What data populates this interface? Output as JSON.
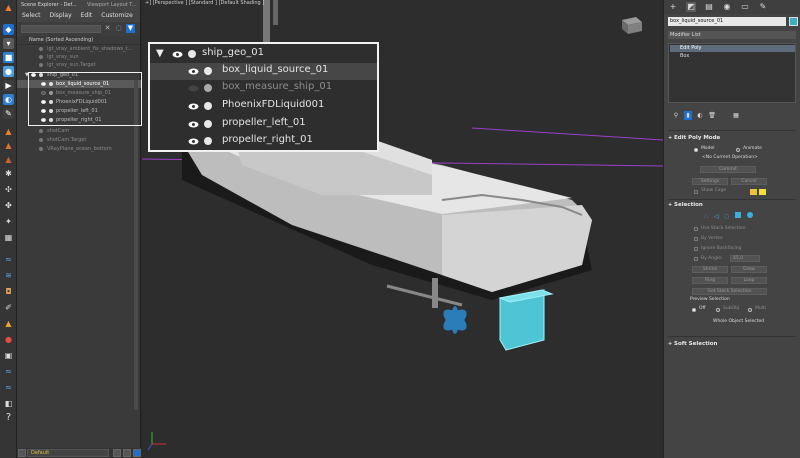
{
  "explorer": {
    "title": "Scene Explorer - Def...",
    "layout_title": "Viewport Layout T...",
    "menu": [
      "Select",
      "Display",
      "Edit",
      "Customize"
    ],
    "column_header": "Name (Sorted Ascending)",
    "rows": [
      {
        "label": "lgt_vray_ambient_fix_shadows_t...",
        "dim": true
      },
      {
        "label": "lgt_vray_sun",
        "dim": true
      },
      {
        "label": "lgt_vray_sun.Target",
        "dim": true
      },
      {
        "label": "ship_geo_01",
        "dim": false
      },
      {
        "label": "box_liquid_source_01",
        "dim": false,
        "selected": true
      },
      {
        "label": "box_measure_ship_01",
        "dim": true
      },
      {
        "label": "PhoenixFDLiquid001",
        "dim": false
      },
      {
        "label": "propeller_left_01",
        "dim": false
      },
      {
        "label": "propeller_right_01",
        "dim": false
      },
      {
        "label": "shotCam",
        "dim": true
      },
      {
        "label": "shotCam.Target",
        "dim": true
      },
      {
        "label": "VRayPlane_ocean_bottom",
        "dim": true
      }
    ],
    "layer": "Default"
  },
  "viewport": {
    "label": "+] [Perspective ] [Standard ] [Default Shading ]"
  },
  "zoom_overlay": {
    "rows": [
      {
        "label": "ship_geo_01"
      },
      {
        "label": "box_liquid_source_01"
      },
      {
        "label": "box_measure_ship_01"
      },
      {
        "label": "PhoenixFDLiquid001"
      },
      {
        "label": "propeller_left_01"
      },
      {
        "label": "propeller_right_01"
      }
    ]
  },
  "command_panel": {
    "object_name": "box_liquid_source_01",
    "modifier_list_label": "Modifier List",
    "modifiers": [
      "Edit Poly",
      "Box"
    ],
    "edit_poly_mode": {
      "title": "Edit Poly Mode",
      "model": "Model",
      "animate": "Animate",
      "current_op": "<No Current Operation>",
      "commit": "Commit",
      "settings": "Settings",
      "cancel": "Cancel",
      "show_cage": "Show Cage"
    },
    "selection": {
      "title": "Selection",
      "use_stack": "Use Stack Selection",
      "by_vertex": "By Vertex",
      "ignore_backfacing": "Ignore Backfacing",
      "by_angle": "By Angle:",
      "angle_value": "45.0",
      "shrink": "Shrink",
      "grow": "Grow",
      "ring": "Ring",
      "loop": "Loop",
      "get_stack": "Get Stack Selection",
      "preview_title": "Preview Selection",
      "off": "Off",
      "subobj": "SubObj",
      "multi": "Multi",
      "whole": "Whole Object Selected"
    },
    "soft_selection_title": "Soft Selection"
  },
  "colors": {
    "accent": "#3ab0c4",
    "selection_blue": "#1f6fd1",
    "grid_line": "#9b3fc8"
  },
  "icons": {
    "cmd_tabs": [
      "create-icon",
      "modify-icon",
      "hierarchy-icon",
      "motion-icon",
      "display-icon",
      "utilities-icon"
    ]
  }
}
